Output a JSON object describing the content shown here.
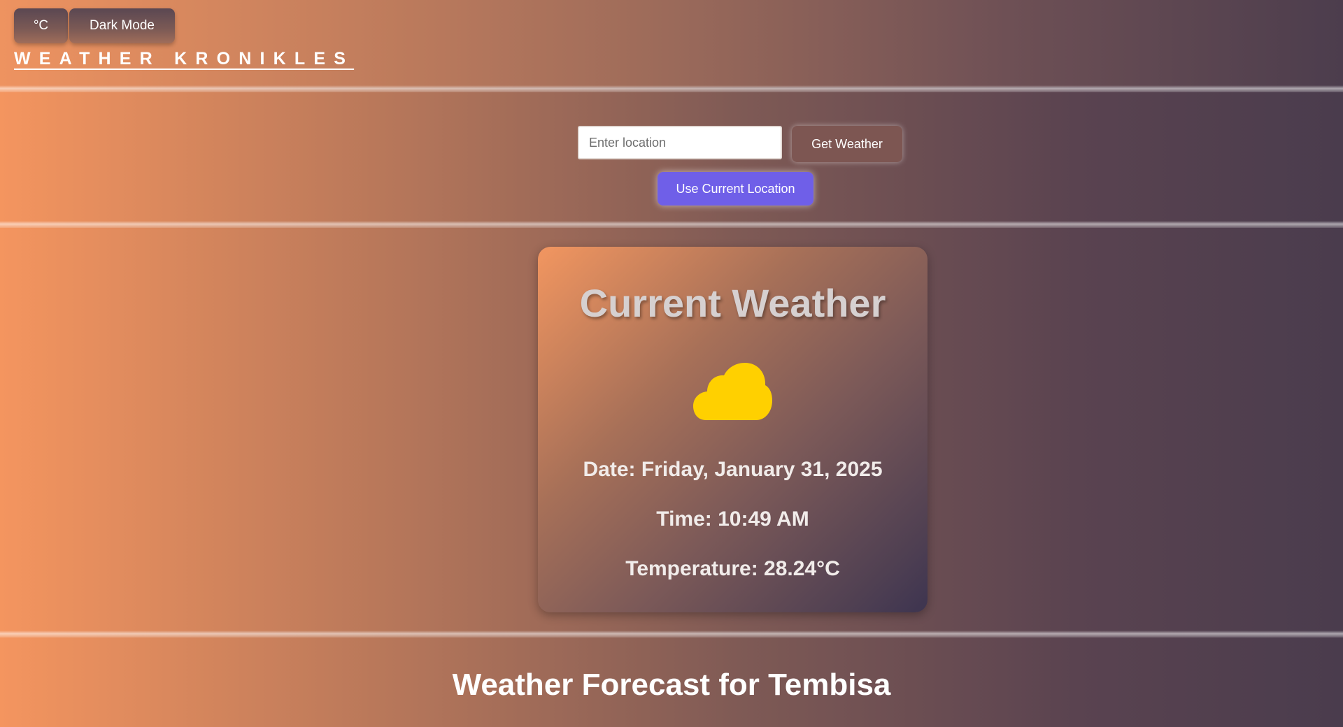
{
  "header": {
    "unit_toggle_label": "°C",
    "dark_mode_label": "Dark Mode",
    "brand": "WEATHER KRONIKLES"
  },
  "search": {
    "placeholder": "Enter location",
    "value": "",
    "get_weather_label": "Get Weather",
    "use_current_location_label": "Use Current Location"
  },
  "current_weather": {
    "title": "Current Weather",
    "icon": "cloud-icon",
    "icon_color": "#ffd000",
    "date": "Date: Friday, January 31, 2025",
    "time": "Time: 10:49 AM",
    "temperature": "Temperature: 28.24°C"
  },
  "forecast": {
    "title": "Weather Forecast for Tembisa"
  },
  "colors": {
    "accent_button": "#6f5fe8",
    "get_weather_button": "#7d5652",
    "gradient_start": "#f4955f",
    "gradient_end": "#4a3c4d"
  }
}
